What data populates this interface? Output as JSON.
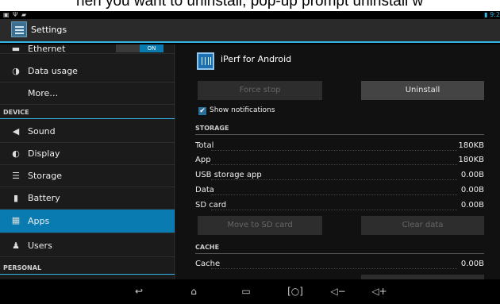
{
  "caption": "hen you want to uninstall, pop-up prompt uninstall w",
  "status": {
    "right_text": "▮ 9:2"
  },
  "actionbar": {
    "title": "Settings"
  },
  "left_list": {
    "ethernet": {
      "label": "Ethernet",
      "toggle": "ON"
    },
    "data_usage": "Data usage",
    "more": "More…",
    "section_device": "DEVICE",
    "sound": "Sound",
    "display": "Display",
    "storage": "Storage",
    "battery": "Battery",
    "apps": "Apps",
    "users": "Users",
    "section_personal": "PERSONAL"
  },
  "app": {
    "name": "iPerf for Android",
    "force_stop": "Force stop",
    "uninstall": "Uninstall",
    "show_notifications": "Show notifications",
    "storage_header": "STORAGE",
    "storage_rows": [
      {
        "key": "Total",
        "value": "180KB"
      },
      {
        "key": "App",
        "value": "180KB"
      },
      {
        "key": "USB storage app",
        "value": "0.00B"
      },
      {
        "key": "Data",
        "value": "0.00B"
      },
      {
        "key": "SD card",
        "value": "0.00B"
      }
    ],
    "move_to_sd": "Move to SD card",
    "clear_data": "Clear data",
    "cache_header": "CACHE",
    "cache_row": {
      "key": "Cache",
      "value": "0.00B"
    }
  },
  "nav_icons": [
    "back-icon",
    "home-icon",
    "recents-icon",
    "screenshot-icon",
    "volume-down-icon",
    "volume-up-icon"
  ],
  "colors": {
    "accent": "#33b5e5",
    "selected": "#0a7bb0"
  }
}
